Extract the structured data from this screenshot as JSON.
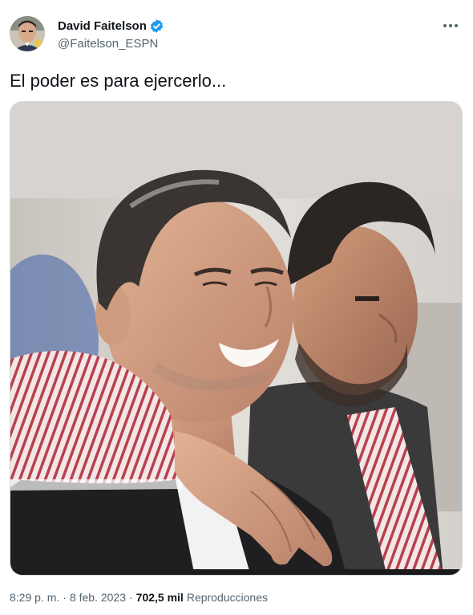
{
  "author": {
    "display_name": "David Faitelson",
    "handle": "@Faitelson_ESPN",
    "verified": true,
    "avatar_icon": "avatar-photo",
    "verified_icon": "verified-badge-icon",
    "verified_color": "#1d9bf0"
  },
  "menu": {
    "icon": "more-options-icon"
  },
  "tweet": {
    "text": "El poder es para ejercerlo..."
  },
  "media": {
    "type": "photo"
  },
  "meta": {
    "time": "8:29 p. m.",
    "separator": "·",
    "date": "8 feb. 2023",
    "separator2": "·",
    "views_count": "702,5 mil",
    "views_label": "Reproducciones"
  }
}
